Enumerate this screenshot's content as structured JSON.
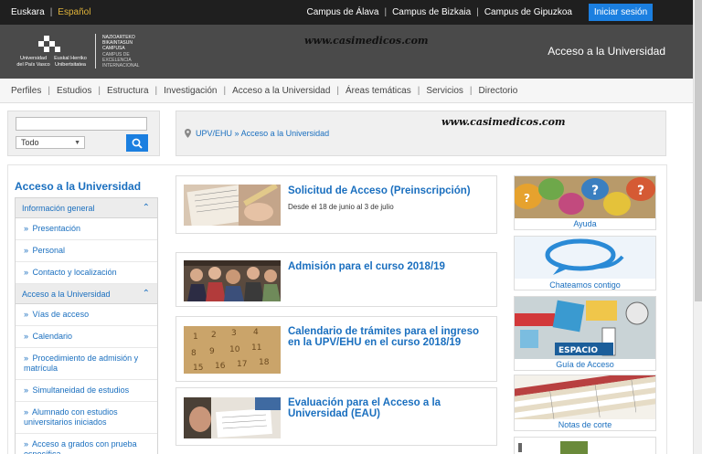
{
  "topbar": {
    "languages": [
      "Euskara",
      "Español"
    ],
    "active_language": "Español",
    "campus_links": [
      "Campus de Álava",
      "Campus de Bizkaia",
      "Campus de Gipuzkoa"
    ],
    "login_label": "Iniciar sesión"
  },
  "header": {
    "logo": {
      "left_name": [
        "Universidad",
        "del País Vasco"
      ],
      "right_name": [
        "Euskal Herriko",
        "Unibertsitatea"
      ],
      "campus_lines": [
        "NAZIOARTEKO",
        "BIKAINTASUN",
        "CAMPUSA"
      ],
      "campus_lines_es": [
        "CAMPUS DE",
        "EXCELENCIA",
        "INTERNACIONAL"
      ]
    },
    "watermark": "www.casimedicos.com",
    "site_title": "Acceso a la Universidad"
  },
  "nav": {
    "items": [
      "Perfiles",
      "Estudios",
      "Estructura",
      "Investigación",
      "Acceso a la Universidad",
      "Áreas temáticas",
      "Servicios",
      "Directorio"
    ]
  },
  "search": {
    "input_value": "",
    "select_value": "Todo",
    "button_icon": "search-icon"
  },
  "breadcrumb": {
    "items": [
      "UPV/EHU",
      "Acceso a la Universidad"
    ],
    "separator": "»",
    "watermark": "www.casimedicos.com"
  },
  "sidebar": {
    "title": "Acceso a la Universidad",
    "sections": [
      {
        "label": "Información general",
        "items": [
          "Presentación",
          "Personal",
          "Contacto y localización"
        ]
      },
      {
        "label": "Acceso a la Universidad",
        "items": [
          "Vías de acceso",
          "Calendario",
          "Procedimiento de admisión y matrícula",
          "Simultaneidad de estudios",
          "Alumnado con estudios universitarios iniciados",
          "Acceso a grados con prueba específica"
        ]
      }
    ]
  },
  "news": [
    {
      "title": "Solicitud de Acceso (Preinscripción)",
      "subtitle": "Desde el 18 de junio al 3 de julio"
    },
    {
      "title": "Admisión para el curso 2018/19",
      "subtitle": ""
    },
    {
      "title": "Calendario de trámites para el ingreso en la UPV/EHU en el curso 2018/19",
      "subtitle": ""
    },
    {
      "title": "Evaluación para el Acceso a la Universidad (EAU)",
      "subtitle": ""
    }
  ],
  "tiles": [
    {
      "label": "Ayuda",
      "image_text": ""
    },
    {
      "label": "Chateamos contigo",
      "image_text": ""
    },
    {
      "label": "Guía de Acceso",
      "image_text": "ESPACIO"
    },
    {
      "label": "Notas de corte",
      "image_text": ""
    }
  ],
  "colors": {
    "accent": "#1a6fbf",
    "button": "#1b7fe0",
    "topbar": "#1f1f1f",
    "header": "#4a4a4a",
    "active_language": "#e0b33a"
  }
}
